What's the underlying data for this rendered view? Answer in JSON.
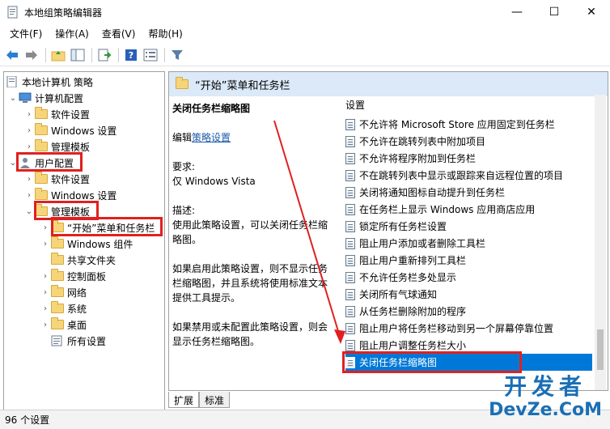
{
  "window": {
    "title": "本地组策略编辑器",
    "minimize": "—",
    "maximize": "☐",
    "close": "✕"
  },
  "menu": [
    "文件(F)",
    "操作(A)",
    "查看(V)",
    "帮助(H)"
  ],
  "toolbar": {
    "icons": [
      "back-arrow-icon",
      "forward-arrow-icon",
      "folder-up-icon",
      "show-hide-tree-icon",
      "export-list-icon",
      "help-icon",
      "properties-icon",
      "filter-icon"
    ]
  },
  "tree": {
    "root": "本地计算机 策略",
    "computer_config": "计算机配置",
    "cc_software": "软件设置",
    "cc_windows": "Windows 设置",
    "cc_admin": "管理模板",
    "user_config": "用户配置",
    "uc_software": "软件设置",
    "uc_windows": "Windows 设置",
    "uc_admin": "管理模板",
    "start_menu": "“开始”菜单和任务栏",
    "windows_components": "Windows 组件",
    "shared_folders": "共享文件夹",
    "control_panel": "控制面板",
    "network": "网络",
    "system": "系统",
    "desktop": "桌面",
    "all_settings": "所有设置"
  },
  "right_pane": {
    "header": "“开始”菜单和任务栏",
    "desc_title": "关闭任务栏缩略图",
    "edit_prefix": "编辑",
    "edit_link": "策略设置",
    "requirements_label": "要求:",
    "requirements_value": "仅 Windows Vista",
    "description_label": "描述:",
    "description_1": "使用此策略设置，可以关闭任务栏缩略图。",
    "description_2": "如果启用此策略设置，则不显示任务栏缩略图，并且系统将使用标准文本提供工具提示。",
    "description_3": "如果禁用或未配置此策略设置，则会显示任务栏缩略图。",
    "settings_header": "设置",
    "settings": [
      "不允许将 Microsoft Store 应用固定到任务栏",
      "不允许在跳转列表中附加项目",
      "不允许将程序附加到任务栏",
      "不在跳转列表中显示或跟踪来自远程位置的项目",
      "关闭将通知图标自动提升到任务栏",
      "在任务栏上显示 Windows 应用商店应用",
      "锁定所有任务栏设置",
      "阻止用户添加或者删除工具栏",
      "阻止用户重新排列工具栏",
      "不允许任务栏多处显示",
      "关闭所有气球通知",
      "从任务栏删除附加的程序",
      "阻止用户将任务栏移动到另一个屏幕停靠位置",
      "阻止用户调整任务栏大小",
      "关闭任务栏缩略图"
    ]
  },
  "tabs": [
    "扩展",
    "标准"
  ],
  "status": "96 个设置",
  "watermark": {
    "top": "开发者",
    "bottom": "DevZe.CoM"
  },
  "colors": {
    "highlight": "#e02020",
    "selection": "#0078d7",
    "header_bg": "#dbe9f9"
  }
}
